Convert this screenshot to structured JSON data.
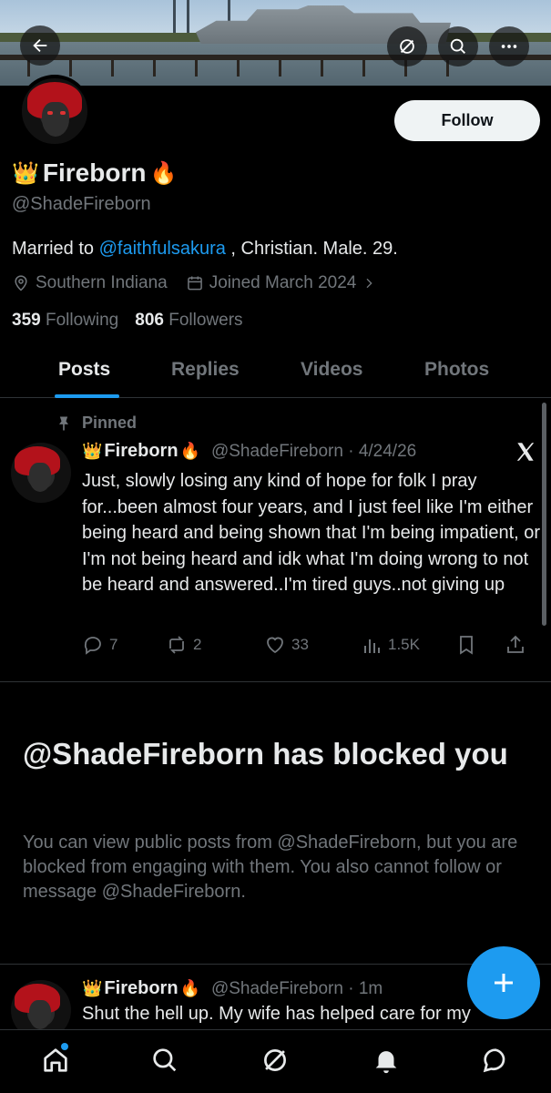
{
  "profile": {
    "display_name": "Fireborn",
    "name_prefix_emoji": "👑",
    "name_suffix_emoji": "🔥",
    "handle": "@ShadeFireborn",
    "bio_prefix": "Married to ",
    "bio_mention": "@faithfulsakura",
    "bio_suffix": " , Christian. Male. 29.",
    "location": "Southern Indiana",
    "joined": "Joined March 2024",
    "following_count": "359",
    "following_label": "Following",
    "followers_count": "806",
    "followers_label": "Followers",
    "follow_button": "Follow"
  },
  "tabs": [
    "Posts",
    "Replies",
    "Videos",
    "Photos"
  ],
  "pinned_post": {
    "pinned_label": "Pinned",
    "name": "Fireborn",
    "handle_date": "@ShadeFireborn · 4/24/26",
    "text": "Just, slowly losing any kind of hope for folk I pray for...been almost four years, and I just feel like I'm either being heard and being shown that I'm being impatient, or I'm not being heard and idk what I'm doing wrong to not be heard and answered..I'm tired guys..not giving up",
    "replies": "7",
    "reposts": "2",
    "likes": "33",
    "views": "1.5K"
  },
  "blocked": {
    "title": "@ShadeFireborn has blocked you",
    "description": "You can view public posts from @ShadeFireborn, but you are blocked from engaging with them. You also cannot follow or message @ShadeFireborn."
  },
  "second_post": {
    "name": "Fireborn",
    "handle_time": "@ShadeFireborn · 1m",
    "text": "Shut the hell up. My wife has helped care for my"
  },
  "colors": {
    "accent": "#1d9bf0",
    "background": "#000000",
    "muted": "#71767b"
  },
  "icons": [
    "back-arrow-icon",
    "grok-icon",
    "search-icon",
    "more-icon",
    "location-icon",
    "calendar-icon",
    "chevron-right-icon",
    "pin-icon",
    "x-logo-icon",
    "reply-icon",
    "repost-icon",
    "like-icon",
    "views-icon",
    "bookmark-icon",
    "share-icon",
    "plus-icon",
    "home-icon",
    "notifications-icon",
    "messages-icon"
  ]
}
